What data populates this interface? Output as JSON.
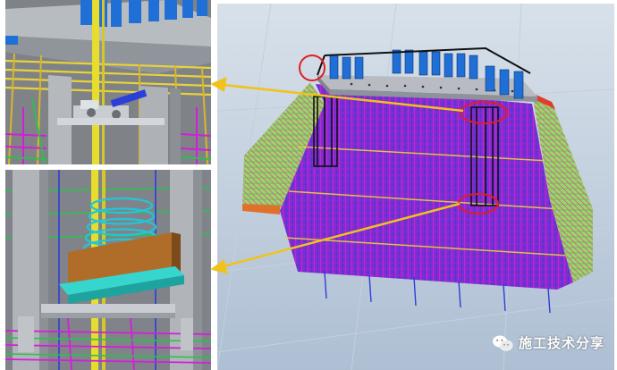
{
  "watermark": {
    "text": "施工技术分享",
    "icon": "wechat-icon"
  },
  "colors": {
    "rebar_yellow": "#e8d23a",
    "rebar_magenta": "#d21fd6",
    "rebar_green": "#29c24a",
    "rebar_blue": "#2b3fd9",
    "rebar_cyan": "#21c6d8",
    "concrete_gray": "#a9acb1",
    "column_blue": "#1f6fd6",
    "callout_line": "#f0c31c",
    "highlight_circle": "#e01e25"
  }
}
